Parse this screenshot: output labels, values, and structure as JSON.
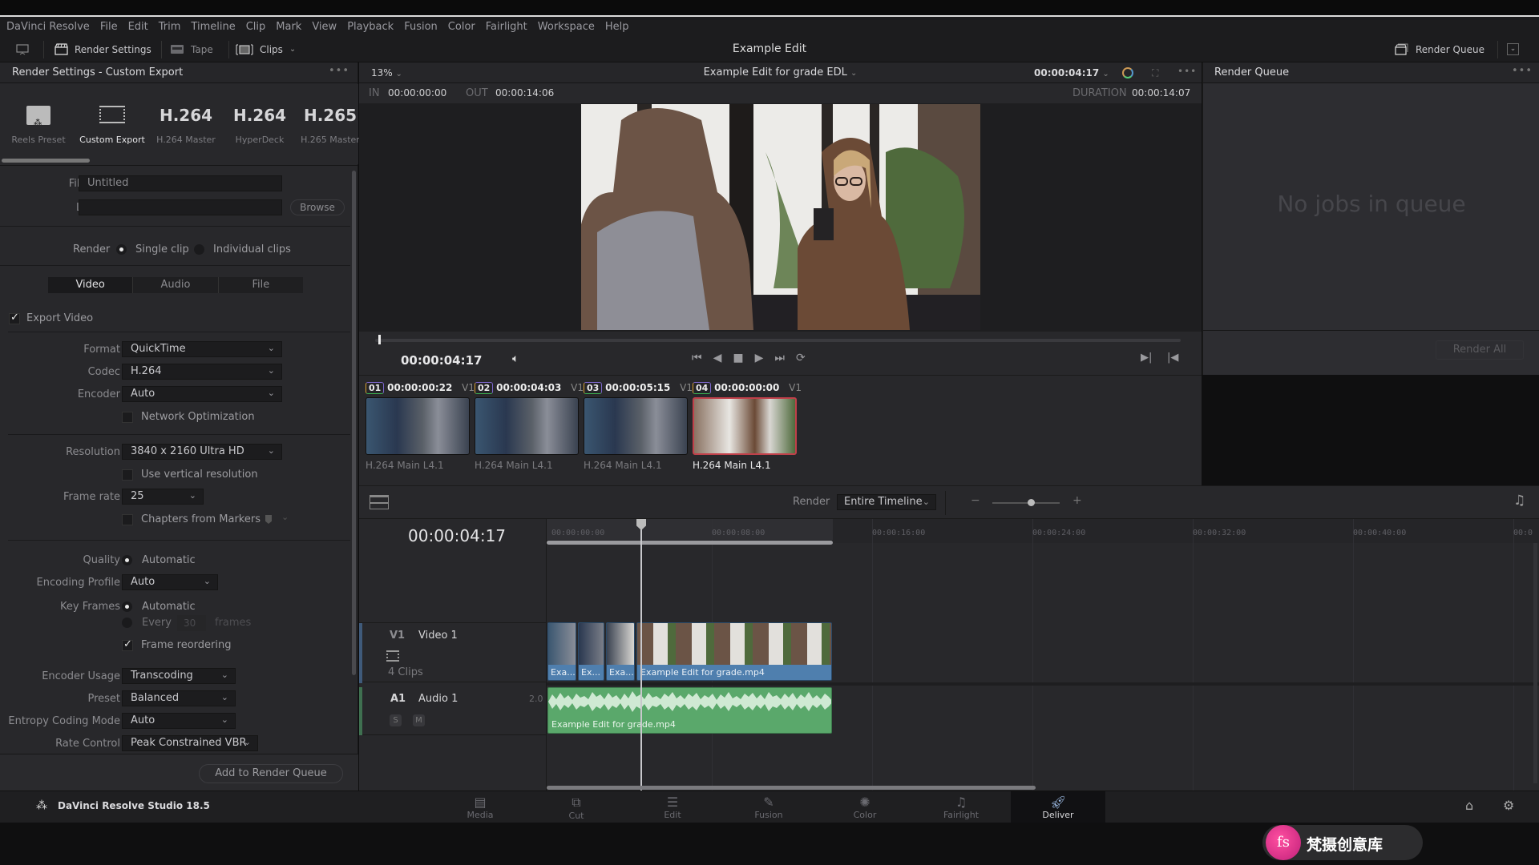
{
  "menu": [
    "DaVinci Resolve",
    "File",
    "Edit",
    "Trim",
    "Timeline",
    "Clip",
    "Mark",
    "View",
    "Playback",
    "Fusion",
    "Color",
    "Fairlight",
    "Workspace",
    "Help"
  ],
  "toolbar": {
    "render_settings": "Render Settings",
    "tape": "Tape",
    "clips": "Clips",
    "app_title": "Example Edit",
    "render_queue": "Render Queue"
  },
  "render_settings": {
    "header": "Render Settings - Custom Export",
    "presets": [
      {
        "big": "",
        "label": "Reels Preset",
        "icon": "reels-preset-icon"
      },
      {
        "big": "",
        "label": "Custom Export",
        "icon": "film-frame-icon"
      },
      {
        "big": "H.264",
        "label": "H.264 Master"
      },
      {
        "big": "H.264",
        "label": "HyperDeck"
      },
      {
        "big": "H.265",
        "label": "H.265 Master"
      }
    ],
    "file_name_label": "File Name",
    "file_name_value": "Untitled",
    "location_label": "Location",
    "location_value": "",
    "browse": "Browse",
    "render_label": "Render",
    "single_clip": "Single clip",
    "individual_clips": "Individual clips",
    "tabs": [
      "Video",
      "Audio",
      "File"
    ],
    "export_video": "Export Video",
    "format_label": "Format",
    "format": "QuickTime",
    "codec_label": "Codec",
    "codec": "H.264",
    "encoder_label": "Encoder",
    "encoder": "Auto",
    "network_opt": "Network Optimization",
    "resolution_label": "Resolution",
    "resolution": "3840 x 2160 Ultra HD",
    "vertical_res": "Use vertical resolution",
    "frame_rate_label": "Frame rate",
    "frame_rate": "25",
    "chapters": "Chapters from Markers",
    "quality_label": "Quality",
    "quality": "Automatic",
    "enc_profile_label": "Encoding Profile",
    "enc_profile": "Auto",
    "key_frames_label": "Key Frames",
    "key_auto": "Automatic",
    "key_every": "Every",
    "key_every_value": "30",
    "key_frames_unit": "frames",
    "frame_reordering": "Frame reordering",
    "enc_usage_label": "Encoder Usage",
    "enc_usage": "Transcoding",
    "preset_label": "Preset",
    "preset": "Balanced",
    "entropy_label": "Entropy Coding Mode",
    "entropy": "Auto",
    "rate_label": "Rate Control",
    "rate": "Peak Constrained VBR",
    "add_to_queue": "Add to Render Queue"
  },
  "viewer": {
    "zoom": "13%",
    "timeline_name": "Example Edit for grade EDL",
    "timecode_top": "00:00:04:17",
    "in_label": "IN",
    "in": "00:00:00:00",
    "out_label": "OUT",
    "out": "00:00:14:06",
    "duration_label": "DURATION",
    "duration": "00:00:14:07",
    "timecode": "00:00:04:17",
    "scrub_position": 0
  },
  "clips": [
    {
      "num": "01",
      "tc": "00:00:00:22",
      "track": "V1",
      "codec": "H.264 Main L4.1",
      "selected": false
    },
    {
      "num": "02",
      "tc": "00:00:04:03",
      "track": "V1",
      "codec": "H.264 Main L4.1",
      "selected": false
    },
    {
      "num": "03",
      "tc": "00:00:05:15",
      "track": "V1",
      "codec": "H.264 Main L4.1",
      "selected": false
    },
    {
      "num": "04",
      "tc": "00:00:00:00",
      "track": "V1",
      "codec": "H.264 Main L4.1",
      "selected": true
    }
  ],
  "timeline": {
    "render_label": "Render",
    "render_mode": "Entire Timeline",
    "timecode": "00:00:04:17",
    "ruler": [
      "00:00:00:00",
      "00:00:08:00",
      "00:00:16:00",
      "00:00:24:00",
      "00:00:32:00",
      "00:00:40:00",
      "00:0"
    ],
    "v1_tag": "V1",
    "v1_name": "Video 1",
    "v1_count": "4 Clips",
    "a1_tag": "A1",
    "a1_name": "Audio 1",
    "a1_channels": "2.0",
    "solo": "S",
    "mute": "M",
    "video_clips": [
      "Exa...",
      "Ex...",
      "Exa...",
      "Example Edit for grade.mp4"
    ],
    "audio_clip": "Example Edit for grade.mp4"
  },
  "render_queue": {
    "header": "Render Queue",
    "empty": "No jobs in queue",
    "render_all": "Render All"
  },
  "pages": [
    "Media",
    "Cut",
    "Edit",
    "Fusion",
    "Color",
    "Fairlight",
    "Deliver"
  ],
  "active_page": "Deliver",
  "brand": "DaVinci Resolve Studio 18.5",
  "watermark": "梵摄创意库",
  "colors": {
    "video_clip": "#4f7fae",
    "audio_clip": "#5aa86b",
    "selected_clip_border": "#c0404a"
  }
}
